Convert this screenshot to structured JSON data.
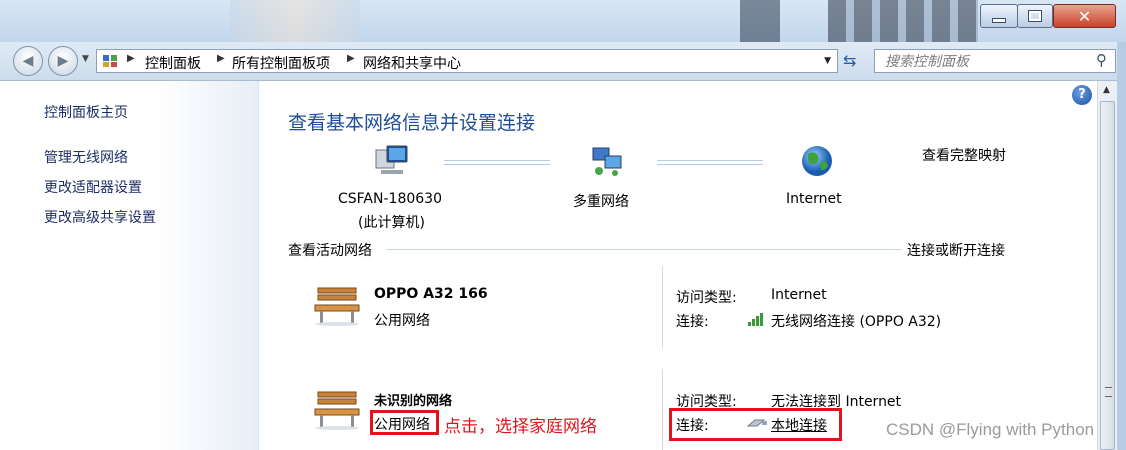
{
  "window": {
    "buttons": {
      "minimize": "minimize",
      "maximize": "maximize",
      "close": "close"
    }
  },
  "nav": {
    "breadcrumb": [
      "控制面板",
      "所有控制面板项",
      "网络和共享中心"
    ],
    "search_placeholder": "搜索控制面板"
  },
  "sidebar": {
    "items": [
      {
        "label": "控制面板主页"
      },
      {
        "label": "管理无线网络"
      },
      {
        "label": "更改适配器设置"
      },
      {
        "label": "更改高级共享设置"
      }
    ]
  },
  "main": {
    "title": "查看基本网络信息并设置连接",
    "full_map_link": "查看完整映射",
    "map": {
      "computer_name": "CSFAN-180630",
      "computer_sub": "(此计算机)",
      "middle": "多重网络",
      "internet": "Internet"
    },
    "active_header": "查看活动网络",
    "connect_link": "连接或断开连接",
    "networks": [
      {
        "name": "OPPO A32  166",
        "type_link": "公用网络",
        "access_label": "访问类型:",
        "access_value": "Internet",
        "conn_label": "连接:",
        "conn_link": "无线网络连接 (OPPO A32)"
      },
      {
        "name": "未识别的网络",
        "type_link": "公用网络",
        "access_label": "访问类型:",
        "access_value": "无法连接到 Internet",
        "conn_label": "连接:",
        "conn_link": "本地连接"
      }
    ],
    "annotation": "点击，选择家庭网络"
  },
  "watermark": "CSDN @Flying with Python",
  "colors": {
    "link": "#1a63c4",
    "title": "#1e4e9a",
    "annotation_red": "#e0141d"
  }
}
